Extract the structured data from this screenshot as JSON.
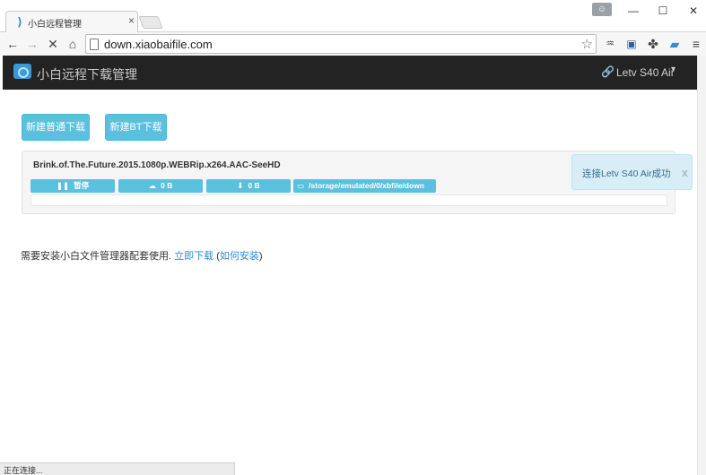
{
  "browser": {
    "tab_title": "小白远程管理",
    "tab_close": "×",
    "url": "down.xiaobaifile.com",
    "status": "正在连接..."
  },
  "icons": {
    "back": "arrow-left-icon",
    "forward": "arrow-right-icon",
    "stop": "stop-icon",
    "home": "home-icon",
    "star": "star-icon",
    "menu": "hamburger-menu-icon"
  },
  "navbar": {
    "title": "小白远程下载管理",
    "device": "Letv S40 Air",
    "background": "#232323"
  },
  "actions": {
    "new_download": "新建普通下载",
    "new_bt": "新建BT下载"
  },
  "task": {
    "name": "Brink.of.The.Future.2015.1080p.WEBRip.x264.AAC-SeeHD",
    "pause_label": "暂停",
    "download_speed": "0 B",
    "upload_speed": "0 B",
    "path": "/storage/emulated/0/xbfile/down",
    "progress": 0
  },
  "toast": {
    "message": "连接Letv S40 Air成功",
    "close": "x"
  },
  "notice": {
    "text": "需要安装小白文件管理器配套使用.",
    "download_link": "立即下载",
    "open_paren": "(",
    "install_link": "如何安装",
    "close_paren": ")"
  },
  "colors": {
    "accent": "#5bc0de",
    "link": "#2a8bd6",
    "toast_bg": "#d9edf7"
  }
}
